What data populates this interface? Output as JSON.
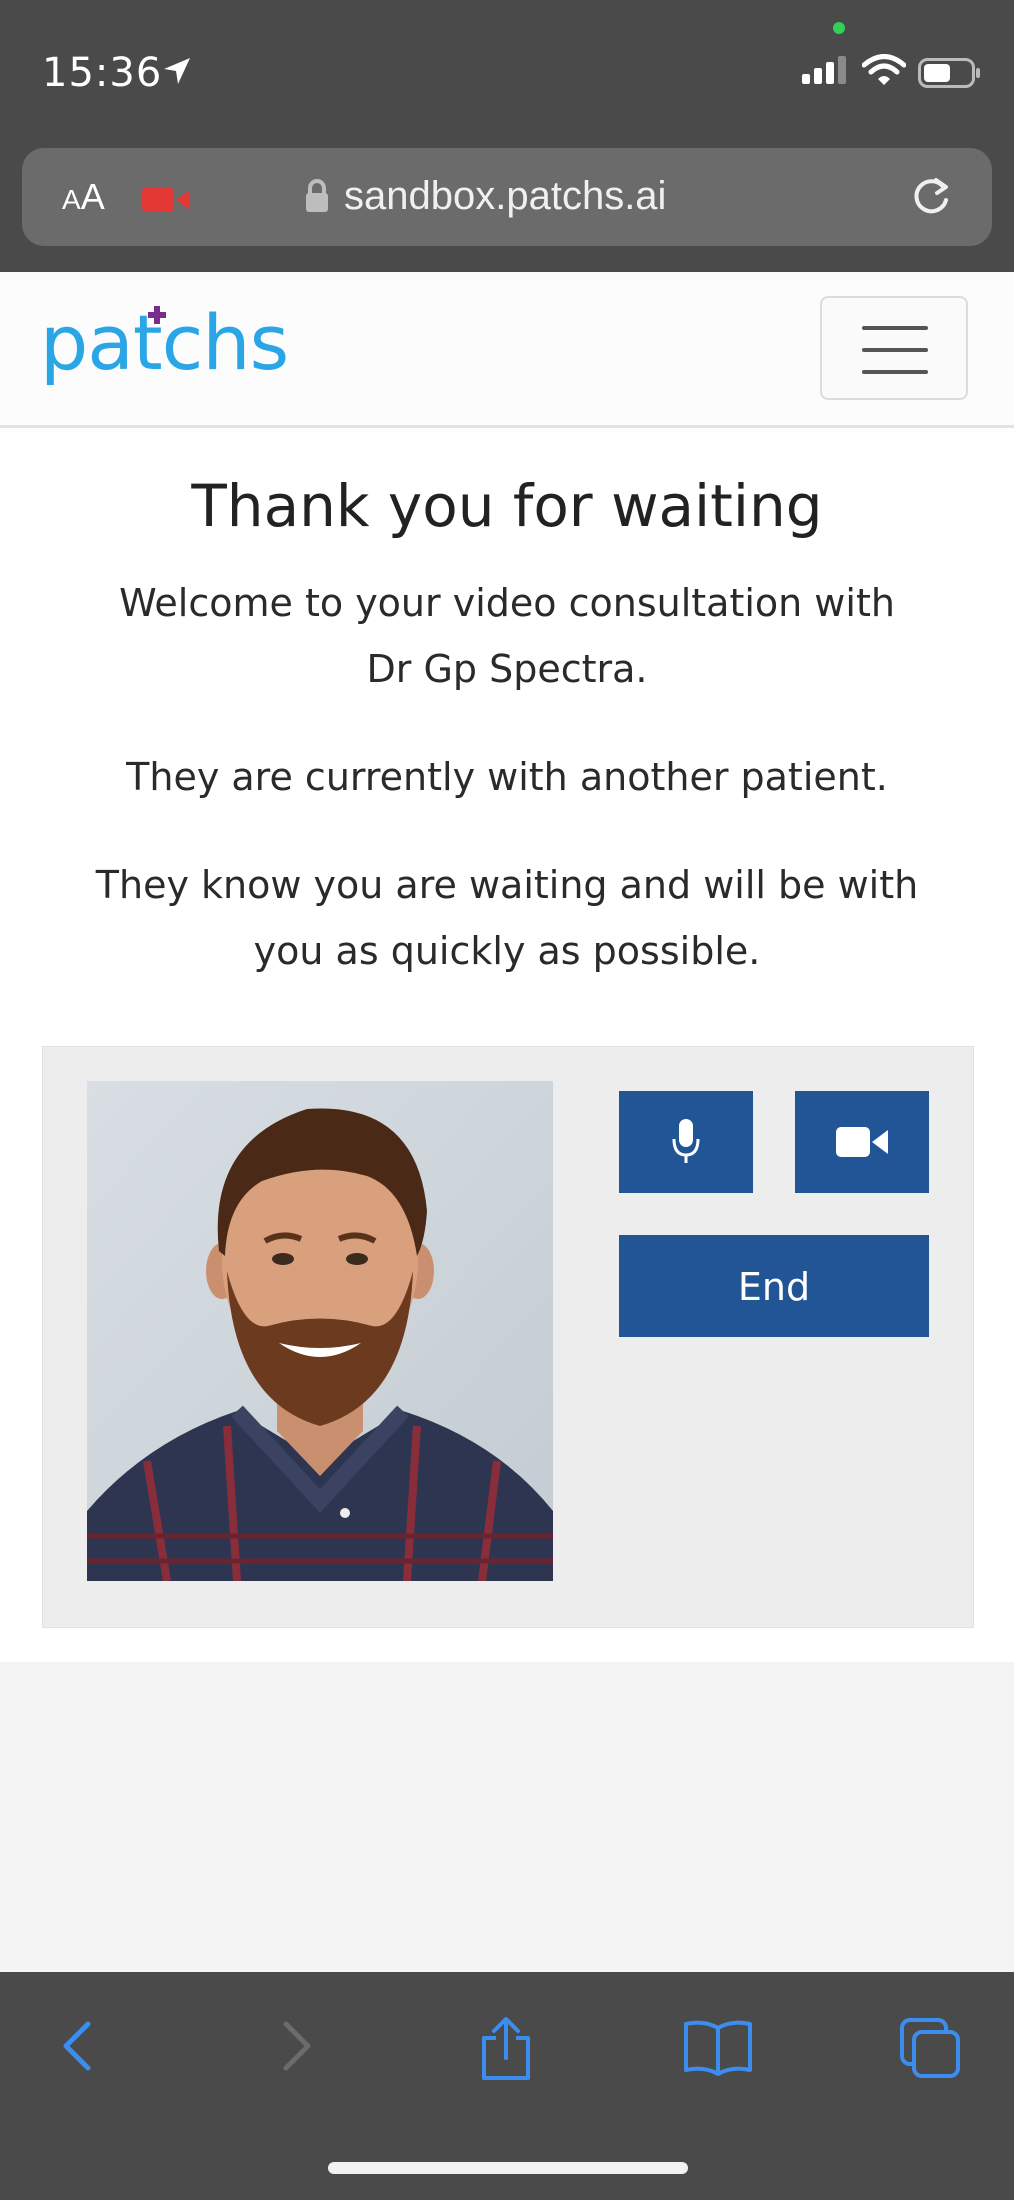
{
  "status_bar": {
    "time": "15:36",
    "icons": [
      "location-arrow-icon",
      "signal-icon",
      "wifi-icon",
      "battery-icon"
    ],
    "mic_camera_indicator_color": "#31d158"
  },
  "browser": {
    "text_size_label_small": "A",
    "text_size_label_large": "A",
    "url": "sandbox.patchs.ai",
    "icons": [
      "text-size-icon",
      "recording-camera-icon",
      "lock-icon",
      "reload-icon"
    ],
    "recording_color": "#e53935"
  },
  "header": {
    "logo_text_left": "pa",
    "logo_text_right": "chs",
    "logo_color": "#2aa6e6",
    "logo_accent_color": "#7b2d8e",
    "menu_icon": "hamburger-icon"
  },
  "main": {
    "title": "Thank you for waiting",
    "welcome_line_1": "Welcome to your video consultation with",
    "welcome_line_2": "Dr Gp Spectra.",
    "status_message": "They are currently with another patient.",
    "waiting_line_1": "They know you are waiting and will be with",
    "waiting_line_2": "you as quickly as possible."
  },
  "video_panel": {
    "end_label": "End",
    "button_color": "#215596",
    "icons": [
      "microphone-icon",
      "video-camera-icon"
    ]
  },
  "toolbar": {
    "icons": [
      "back-icon",
      "forward-icon",
      "share-icon",
      "bookmarks-icon",
      "tabs-icon"
    ],
    "icon_color": "#3b8ef0"
  }
}
